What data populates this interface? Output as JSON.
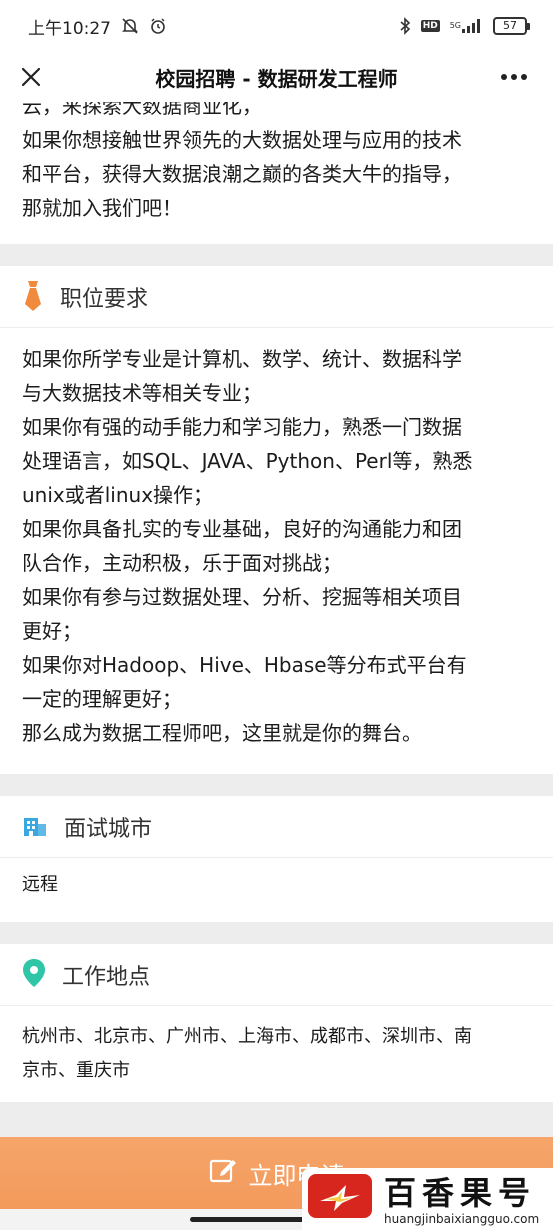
{
  "status_bar": {
    "time": "上午10:27",
    "network": "5G",
    "battery": "57",
    "hd": "HD"
  },
  "titlebar": {
    "title": "校园招聘 - 数据研发工程师"
  },
  "intro": {
    "clipped_line": "云，来探索大数据商业化，",
    "lines": [
      "如果你想接触世界领先的大数据处理与应用的技术",
      "和平台，获得大数据浪潮之巅的各类大牛的指导，",
      "那就加入我们吧！"
    ]
  },
  "requirements": {
    "title": "职位要求",
    "lines": [
      "如果你所学专业是计算机、数学、统计、数据科学",
      "与大数据技术等相关专业；",
      "如果你有强的动手能力和学习能力，熟悉一门数据",
      "处理语言，如SQL、JAVA、Python、Perl等，熟悉",
      "unix或者linux操作；",
      "如果你具备扎实的专业基础，良好的沟通能力和团",
      "队合作，主动积极，乐于面对挑战；",
      "如果你有参与过数据处理、分析、挖掘等相关项目",
      "更好；",
      "如果你对Hadoop、Hive、Hbase等分布式平台有",
      "一定的理解更好；",
      "那么成为数据工程师吧，这里就是你的舞台。"
    ]
  },
  "interview_city": {
    "title": "面试城市",
    "value": "远程"
  },
  "work_location": {
    "title": "工作地点",
    "lines": [
      "杭州市、北京市、广州市、上海市、成都市、深圳市、南",
      "京市、重庆市"
    ]
  },
  "apply": {
    "label": "立即申请"
  },
  "watermark": {
    "title": "百香果号",
    "subtitle": "huangjinbaixiangguo.com"
  },
  "colors": {
    "accent": "#f39a5c",
    "icon_orange": "#f08a3c",
    "icon_blue": "#3aa8e0",
    "icon_teal": "#2fc6a8"
  }
}
